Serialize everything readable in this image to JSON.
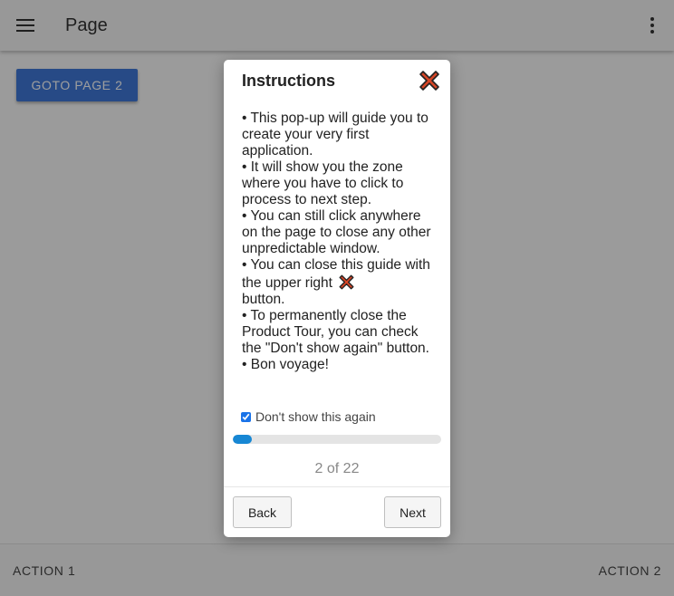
{
  "appbar": {
    "title": "Page"
  },
  "main": {
    "goto_label": "GOTO PAGE 2"
  },
  "bottombar": {
    "action1": "ACTION 1",
    "action2": "ACTION 2"
  },
  "dialog": {
    "title": "Instructions",
    "lines": [
      "• This pop-up will guide you to create your very first application.",
      "• It will show you the zone where you have to click to process to next step.",
      "• You can still click anywhere on the page to close any other unpredictable window.",
      "• You can close this guide with the upper right",
      "button.",
      "• To permanently close the Product Tour, you can check the \"Don't show again\" button.",
      "• Bon voyage!"
    ],
    "dont_show_label": "Don't show this again",
    "dont_show_checked": true,
    "progress_current": 2,
    "progress_total": 22,
    "step_text": "2 of 22",
    "back_label": "Back",
    "next_label": "Next"
  },
  "icons": {
    "menu": "hamburger-menu-icon",
    "more": "more-vert-icon",
    "close": "close-x-icon"
  },
  "colors": {
    "primary_button": "#3f78d8",
    "progress": "#1787d4",
    "close_icon_fill": "#d64526",
    "close_icon_stroke": "#222222"
  }
}
